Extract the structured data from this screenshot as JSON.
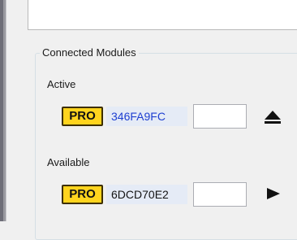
{
  "group": {
    "title": "Connected Modules"
  },
  "active": {
    "label": "Active",
    "badge": "PRO",
    "module_id": "346FA9FC",
    "input_value": "",
    "action_icon": "eject-icon"
  },
  "available": {
    "label": "Available",
    "badge": "PRO",
    "module_id": "6DCD70E2",
    "input_value": "",
    "action_icon": "play-icon"
  },
  "colors": {
    "badge_fill": "#ffd41e",
    "badge_border": "#3d2f00",
    "active_id_text": "#1e3fd1",
    "module_id_bg": "#e5ebf6"
  }
}
